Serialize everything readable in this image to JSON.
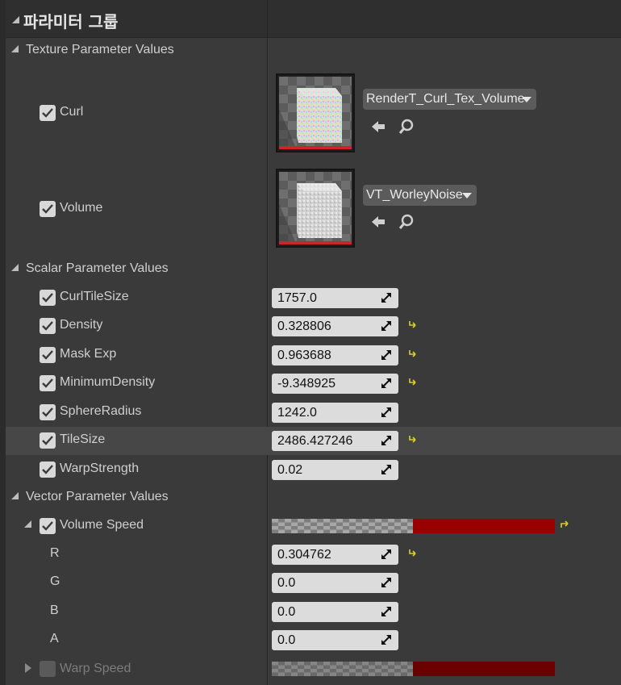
{
  "header": {
    "title": "파라미터 그룹"
  },
  "sections": {
    "texture": {
      "label": "Texture Parameter Values"
    },
    "scalar": {
      "label": "Scalar Parameter Values"
    },
    "vector": {
      "label": "Vector Parameter Values"
    }
  },
  "textures": [
    {
      "name": "Curl",
      "asset": "RenderT_Curl_Tex_Volume",
      "checked": true
    },
    {
      "name": "Volume",
      "asset": "VT_WorleyNoise",
      "checked": true
    }
  ],
  "scalars": [
    {
      "name": "CurlTileSize",
      "value": "1757.0",
      "modified": false
    },
    {
      "name": "Density",
      "value": "0.328806",
      "modified": true
    },
    {
      "name": "Mask Exp",
      "value": "0.963688",
      "modified": true
    },
    {
      "name": "MinimumDensity",
      "value": "-9.348925",
      "modified": true
    },
    {
      "name": "SphereRadius",
      "value": "1242.0",
      "modified": false
    },
    {
      "name": "TileSize",
      "value": "2486.427246",
      "modified": true
    },
    {
      "name": "WarpStrength",
      "value": "0.02",
      "modified": false
    }
  ],
  "vectors": {
    "volume_speed": {
      "name": "Volume Speed",
      "color": "#990000",
      "components": [
        {
          "name": "R",
          "value": "0.304762",
          "modified": true
        },
        {
          "name": "G",
          "value": "0.0",
          "modified": false
        },
        {
          "name": "B",
          "value": "0.0",
          "modified": false
        },
        {
          "name": "A",
          "value": "0.0",
          "modified": false
        }
      ]
    },
    "warp_speed": {
      "name": "Warp Speed",
      "color": "#6a0000"
    }
  },
  "icons": {
    "use_selected": "arrow-left-icon",
    "browse": "magnifier-icon",
    "drag": "drag-handle-icon",
    "reset": "reset-to-default-icon"
  },
  "colors": {
    "reset_arrow": "#d9cf2a",
    "thumb_redbar": "#c8262a"
  }
}
